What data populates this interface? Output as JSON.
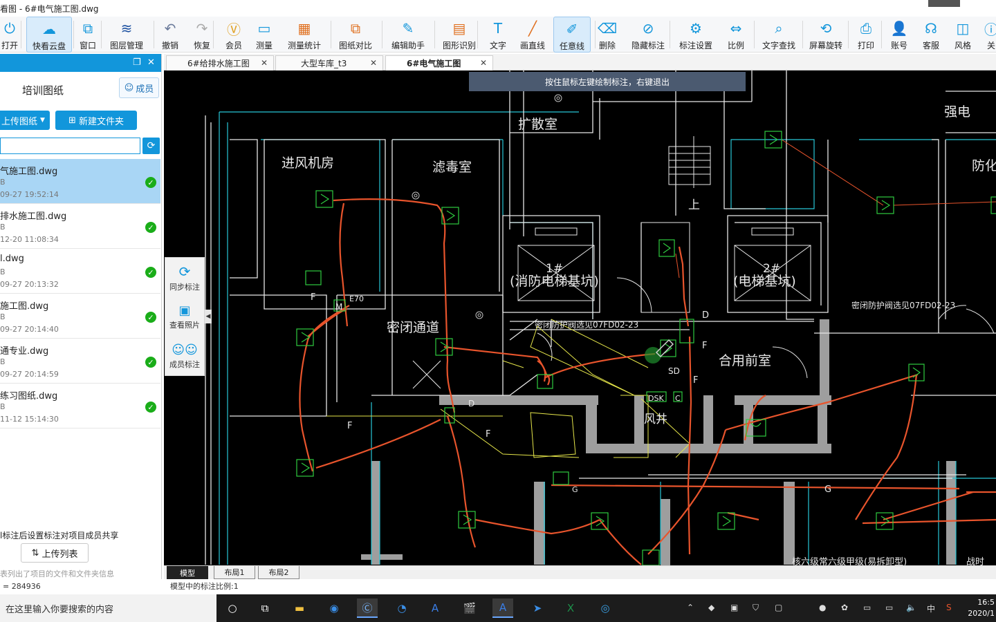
{
  "window": {
    "title": "看图 - 6#电气施工图.dwg"
  },
  "toolbar": {
    "items": [
      {
        "label": "打开",
        "icon": "power-icon"
      },
      {
        "label": "快看云盘",
        "icon": "cloud-icon"
      },
      {
        "label": "窗口",
        "icon": "window-icon"
      },
      {
        "label": "图层管理",
        "icon": "layers-icon"
      },
      {
        "label": "撤销",
        "icon": "undo-icon"
      },
      {
        "label": "恢复",
        "icon": "redo-icon"
      },
      {
        "label": "会员",
        "icon": "vip-icon"
      },
      {
        "label": "测量",
        "icon": "ruler-icon"
      },
      {
        "label": "测量统计",
        "icon": "measure-stats-icon"
      },
      {
        "label": "图纸对比",
        "icon": "compare-icon"
      },
      {
        "label": "编辑助手",
        "icon": "edit-assistant-icon"
      },
      {
        "label": "图形识别",
        "icon": "shape-recognition-icon"
      },
      {
        "label": "文字",
        "icon": "text-icon"
      },
      {
        "label": "画直线",
        "icon": "line-icon"
      },
      {
        "label": "任意线",
        "icon": "pen-icon"
      },
      {
        "label": "删除",
        "icon": "eraser-icon"
      },
      {
        "label": "隐藏标注",
        "icon": "hide-icon"
      },
      {
        "label": "标注设置",
        "icon": "annotation-settings-icon"
      },
      {
        "label": "比例",
        "icon": "scale-icon"
      },
      {
        "label": "文字查找",
        "icon": "text-search-icon"
      },
      {
        "label": "屏幕旋转",
        "icon": "rotate-screen-icon"
      },
      {
        "label": "打印",
        "icon": "printer-icon"
      },
      {
        "label": "账号",
        "icon": "user-icon"
      },
      {
        "label": "客服",
        "icon": "headset-icon"
      },
      {
        "label": "风格",
        "icon": "style-icon"
      },
      {
        "label": "关",
        "icon": "about-icon"
      }
    ]
  },
  "left_panel": {
    "title": "培训图纸",
    "member_button": "成员",
    "upload_button": "上传图纸",
    "new_folder_button": "新建文件夹",
    "search_value": "",
    "files": [
      {
        "name": "气施工图.dwg",
        "size": "B",
        "date": "09-27 19:52:14",
        "selected": true
      },
      {
        "name": "排水施工图.dwg",
        "size": "B",
        "date": "12-20 11:08:34",
        "selected": false
      },
      {
        "name": "l.dwg",
        "size": "B",
        "date": "09-27 20:13:32",
        "selected": false
      },
      {
        "name": "施工图.dwg",
        "size": "B",
        "date": "09-27 20:14:40",
        "selected": false
      },
      {
        "name": "通专业.dwg",
        "size": "B",
        "date": "09-27 20:14:59",
        "selected": false
      },
      {
        "name": "练习图纸.dwg",
        "size": "B",
        "date": "11-12 15:14:30",
        "selected": false
      }
    ],
    "note": "l标注后设置标注对项目成员共享",
    "upload_list_button": "上传列表",
    "info": "表列出了项目的文件和文件夹信息",
    "coord": "= 284936"
  },
  "float_tools": [
    {
      "label": "同步标注",
      "icon": "sync-icon"
    },
    {
      "label": "查看照片",
      "icon": "photo-icon"
    },
    {
      "label": "成员标注",
      "icon": "members-icon"
    }
  ],
  "tabs": [
    {
      "label": "6#给排水施工图",
      "active": false
    },
    {
      "label": "大型车库_t3",
      "active": false
    },
    {
      "label": "6#电气施工图",
      "active": true
    }
  ],
  "canvas": {
    "hint": "按住鼠标左键绘制标注，右键退出",
    "room_labels": [
      "进风机房",
      "滤毒室",
      "扩散室",
      "强电",
      "防化值",
      "密闭通道",
      "(消防电梯基坑)",
      "(电梯基坑)",
      "合用前室",
      "风井",
      "上",
      "1#",
      "2#",
      "密闭防护阀选见07FD02-23",
      "密闭防护阀选见07FD02-23",
      "F",
      "M",
      "E70",
      "D",
      "SD",
      "DSK",
      "C",
      "G",
      "核六级常六级甲级(易拆卸型)",
      "战时"
    ]
  },
  "layout_tabs": [
    {
      "label": "模型",
      "active": true
    },
    {
      "label": "布局1",
      "active": false
    },
    {
      "label": "布局2",
      "active": false
    }
  ],
  "status": {
    "scale_text": "模型中的标注比例:1"
  },
  "taskbar": {
    "search_placeholder": "在这里输入你要搜索的内容",
    "apps": [
      "cortana-icon",
      "task-view-icon",
      "file-explorer-icon",
      "edge-icon",
      "cad-viewer-icon",
      "browser-icon",
      "app-a-icon",
      "video-icon",
      "app-a2-icon",
      "feishu-icon",
      "excel-icon",
      "search-app-icon"
    ],
    "tray_ime": "中",
    "time": "16:5",
    "date": "2020/1"
  },
  "colors": {
    "accent": "#1296db",
    "canvas_bg": "#000000",
    "wall": "#ffffff",
    "cyan": "#28c8d8",
    "green": "#2ecc40",
    "red_line": "#e8542c",
    "gray_wall": "#9e9e9e"
  }
}
